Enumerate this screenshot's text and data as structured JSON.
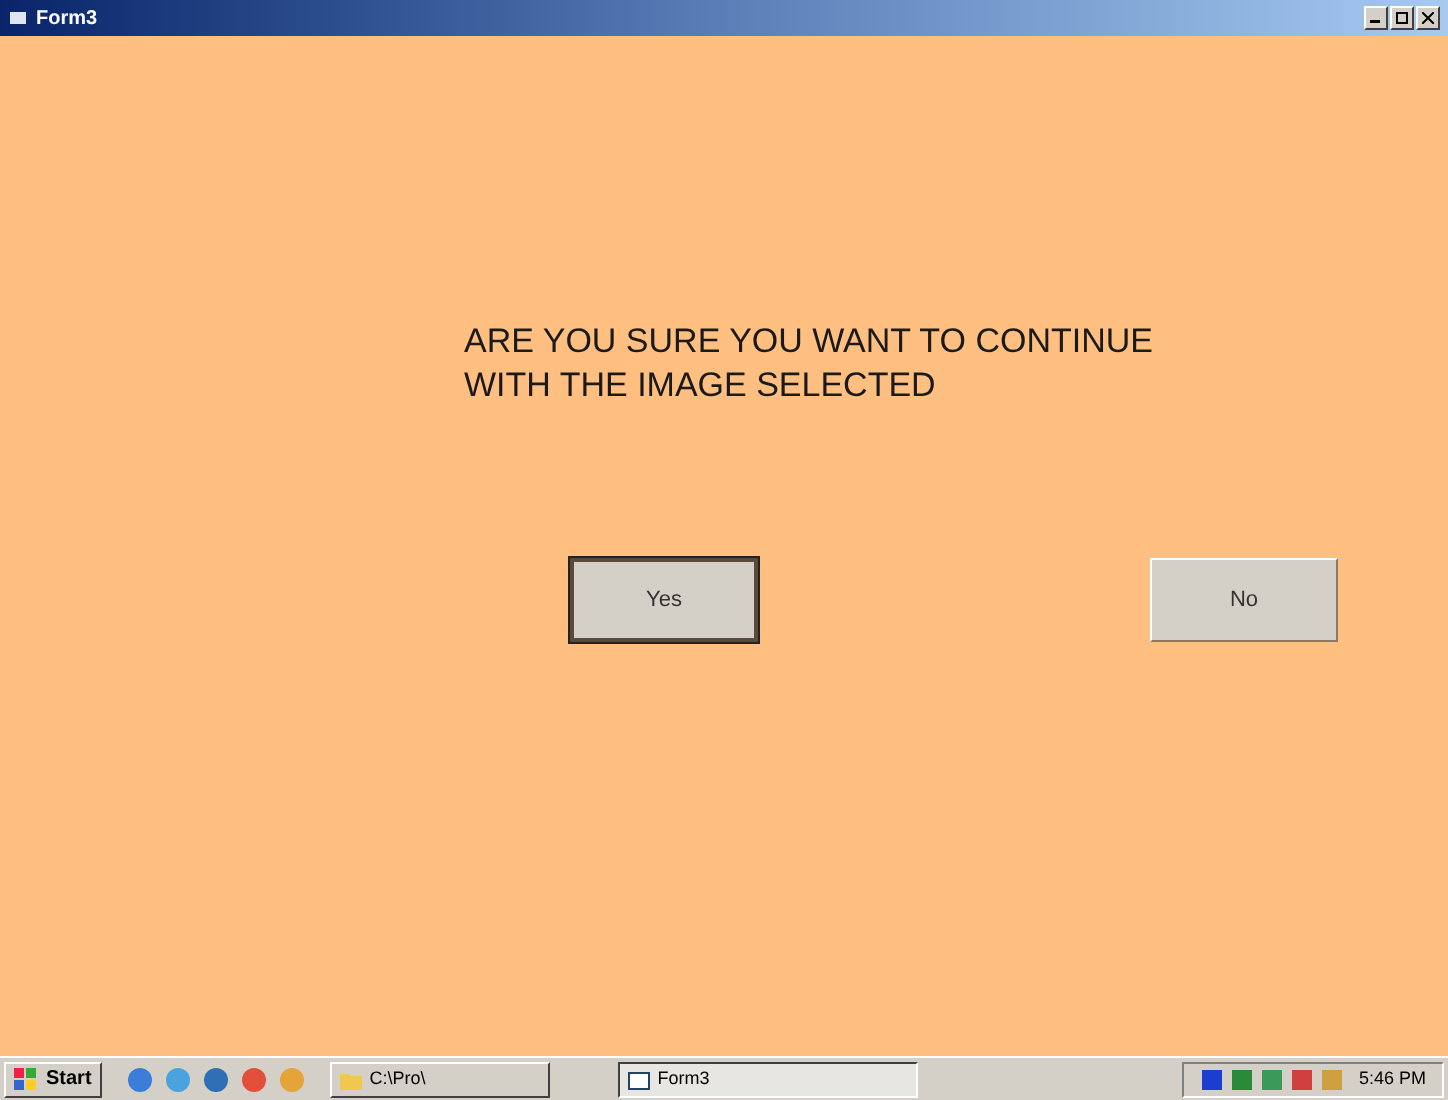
{
  "window": {
    "title": "Form3"
  },
  "message": [
    "ARE YOU SURE YOU WANT TO CONTINUE",
    "WITH THE IMAGE SELECTED"
  ],
  "buttons": [
    {
      "label": "Yes",
      "focused": true
    },
    {
      "label": "No",
      "focused": false
    }
  ],
  "taskbar": {
    "start": "Start",
    "tasks": [
      {
        "label": "C:\\Pro\\",
        "selected": false
      },
      {
        "label": "Form3",
        "selected": true
      }
    ],
    "clock": "5:46 PM"
  }
}
